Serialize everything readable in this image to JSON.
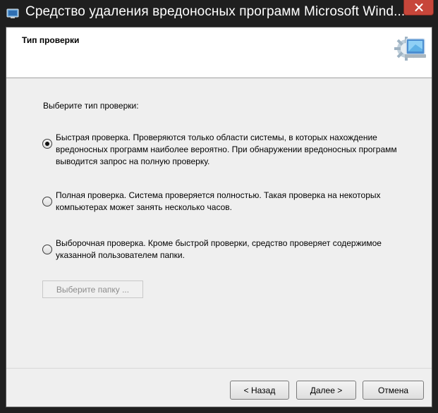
{
  "window": {
    "title": "Средство удаления вредоносных программ Microsoft Wind..."
  },
  "header": {
    "title": "Тип проверки"
  },
  "content": {
    "prompt": "Выберите тип проверки:",
    "options": [
      {
        "label": "Быстрая проверка. Проверяются только области системы, в которых нахождение вредоносных программ наиболее вероятно. При обнаружении вредоносных программ выводится запрос на полную проверку.",
        "checked": true
      },
      {
        "label": "Полная проверка. Система проверяется полностью. Такая проверка на некоторых компьютерах может занять несколько часов.",
        "checked": false
      },
      {
        "label": "Выборочная проверка. Кроме быстрой проверки, средство проверяет содержимое указанной пользователем папки.",
        "checked": false
      }
    ],
    "folder_button": "Выберите папку ..."
  },
  "footer": {
    "back": "< Назад",
    "next": "Далее >",
    "cancel": "Отмена"
  }
}
